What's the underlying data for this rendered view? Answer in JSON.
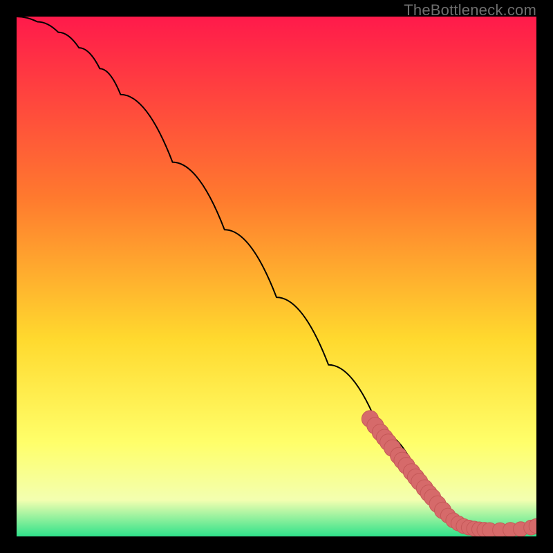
{
  "watermark": "TheBottleneck.com",
  "colors": {
    "gradient_top": "#ff1a4b",
    "gradient_mid1": "#ff7a2e",
    "gradient_mid2": "#ffd92e",
    "gradient_mid3": "#ffff6a",
    "gradient_mid4": "#f3ffb0",
    "gradient_bottom": "#2fe28a",
    "curve": "#000000",
    "marker_fill": "#d66a6a",
    "marker_stroke": "#c55858"
  },
  "chart_data": {
    "type": "line",
    "title": "",
    "xlabel": "",
    "ylabel": "",
    "xlim": [
      0,
      100
    ],
    "ylim": [
      0,
      100
    ],
    "grid": false,
    "curve": [
      {
        "x": 0,
        "y": 100
      },
      {
        "x": 4,
        "y": 99
      },
      {
        "x": 8,
        "y": 97
      },
      {
        "x": 12,
        "y": 94
      },
      {
        "x": 16,
        "y": 90
      },
      {
        "x": 20,
        "y": 85
      },
      {
        "x": 30,
        "y": 72
      },
      {
        "x": 40,
        "y": 59
      },
      {
        "x": 50,
        "y": 46
      },
      {
        "x": 60,
        "y": 33
      },
      {
        "x": 70,
        "y": 20
      },
      {
        "x": 78,
        "y": 10
      },
      {
        "x": 82,
        "y": 5
      },
      {
        "x": 85,
        "y": 2.5
      },
      {
        "x": 88,
        "y": 1.5
      },
      {
        "x": 92,
        "y": 1.2
      },
      {
        "x": 96,
        "y": 1.3
      },
      {
        "x": 100,
        "y": 2
      }
    ],
    "markers": [
      {
        "x": 68,
        "y": 22.6,
        "r": 1.2
      },
      {
        "x": 69,
        "y": 21.3,
        "r": 1.2
      },
      {
        "x": 70,
        "y": 20.0,
        "r": 1.2
      },
      {
        "x": 70.8,
        "y": 19.0,
        "r": 1.2
      },
      {
        "x": 71.5,
        "y": 18.1,
        "r": 1.2
      },
      {
        "x": 72.3,
        "y": 17.0,
        "r": 1.2
      },
      {
        "x": 73.5,
        "y": 15.5,
        "r": 1.2
      },
      {
        "x": 74.2,
        "y": 14.6,
        "r": 1.2
      },
      {
        "x": 75.0,
        "y": 13.6,
        "r": 1.2
      },
      {
        "x": 76.0,
        "y": 12.4,
        "r": 1.2
      },
      {
        "x": 76.8,
        "y": 11.4,
        "r": 1.2
      },
      {
        "x": 77.5,
        "y": 10.5,
        "r": 1.2
      },
      {
        "x": 78.5,
        "y": 9.3,
        "r": 1.2
      },
      {
        "x": 79.3,
        "y": 8.3,
        "r": 1.2
      },
      {
        "x": 80.0,
        "y": 7.5,
        "r": 1.2
      },
      {
        "x": 81.0,
        "y": 6.2,
        "r": 1.2
      },
      {
        "x": 82.0,
        "y": 5.0,
        "r": 1.2
      },
      {
        "x": 83.0,
        "y": 4.0,
        "r": 1.0
      },
      {
        "x": 84.0,
        "y": 3.1,
        "r": 1.0
      },
      {
        "x": 85.0,
        "y": 2.5,
        "r": 1.0
      },
      {
        "x": 86.0,
        "y": 2.0,
        "r": 1.0
      },
      {
        "x": 87.0,
        "y": 1.7,
        "r": 1.0
      },
      {
        "x": 88.0,
        "y": 1.5,
        "r": 1.0
      },
      {
        "x": 89.0,
        "y": 1.35,
        "r": 1.0
      },
      {
        "x": 90.0,
        "y": 1.27,
        "r": 1.0
      },
      {
        "x": 91.0,
        "y": 1.22,
        "r": 1.0
      },
      {
        "x": 93.0,
        "y": 1.21,
        "r": 1.0
      },
      {
        "x": 95.0,
        "y": 1.25,
        "r": 1.0
      },
      {
        "x": 97.0,
        "y": 1.4,
        "r": 1.0
      },
      {
        "x": 99.0,
        "y": 1.7,
        "r": 1.0
      },
      {
        "x": 100.0,
        "y": 2.0,
        "r": 1.0
      }
    ]
  }
}
